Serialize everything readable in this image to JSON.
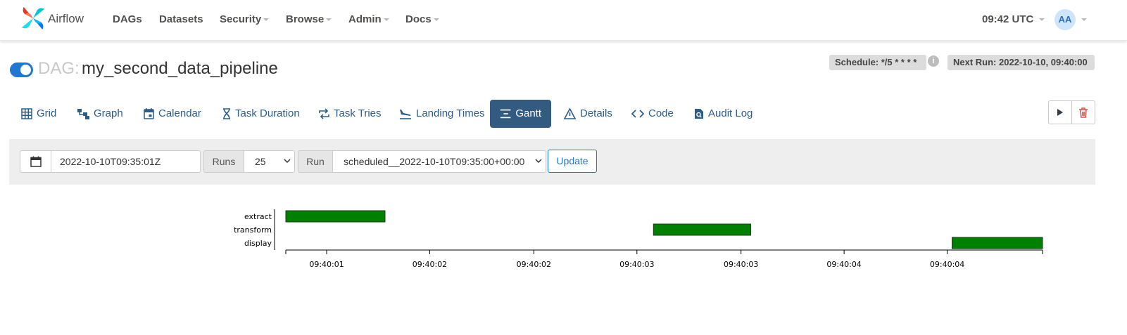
{
  "navbar": {
    "brand": "Airflow",
    "items": [
      {
        "label": "DAGs",
        "dropdown": false
      },
      {
        "label": "Datasets",
        "dropdown": false
      },
      {
        "label": "Security",
        "dropdown": true
      },
      {
        "label": "Browse",
        "dropdown": true
      },
      {
        "label": "Admin",
        "dropdown": true
      },
      {
        "label": "Docs",
        "dropdown": true
      }
    ],
    "clock": "09:42 UTC",
    "user_initials": "AA"
  },
  "dag": {
    "label": "DAG:",
    "id": "my_second_data_pipeline",
    "paused": false,
    "schedule": "Schedule: */5 * * * *",
    "next_run": "Next Run: 2022-10-10, 09:40:00"
  },
  "tabs": [
    {
      "label": "Grid",
      "icon": "grid-icon",
      "active": false
    },
    {
      "label": "Graph",
      "icon": "graph-icon",
      "active": false
    },
    {
      "label": "Calendar",
      "icon": "calendar-icon",
      "active": false
    },
    {
      "label": "Task Duration",
      "icon": "hourglass-icon",
      "active": false
    },
    {
      "label": "Task Tries",
      "icon": "repeat-icon",
      "active": false
    },
    {
      "label": "Landing Times",
      "icon": "plane-landing-icon",
      "active": false
    },
    {
      "label": "Gantt",
      "icon": "gantt-icon",
      "active": true
    },
    {
      "label": "Details",
      "icon": "warning-triangle-icon",
      "active": false
    },
    {
      "label": "Code",
      "icon": "code-icon",
      "active": false
    },
    {
      "label": "Audit Log",
      "icon": "file-search-icon",
      "active": false
    }
  ],
  "filters": {
    "base_date": "2022-10-10T09:35:01Z",
    "runs_label": "Runs",
    "runs_value": "25",
    "run_label": "Run",
    "run_value": "scheduled__2022-10-10T09:35:00+00:00",
    "update_label": "Update"
  },
  "colors": {
    "accent": "#1f78d1",
    "active_tab": "#335b82",
    "task_success": "#008000",
    "delete": "#d9534f"
  },
  "chart_data": {
    "type": "gantt",
    "tasks": [
      {
        "name": "extract",
        "start": 0.0,
        "end": 1.02,
        "state": "success"
      },
      {
        "name": "transform",
        "start": 3.78,
        "end": 4.78,
        "state": "success"
      },
      {
        "name": "display",
        "start": 6.85,
        "end": 7.78,
        "state": "success"
      }
    ],
    "time_unit": "seconds from first tick origin",
    "xlim": [
      0,
      7.78
    ],
    "tick_positions": [
      0.42,
      1.48,
      2.55,
      3.61,
      4.68,
      5.74,
      6.8
    ],
    "tick_labels": [
      "09:40:01",
      "09:40:02",
      "09:40:02",
      "09:40:03",
      "09:40:03",
      "09:40:04",
      "09:40:04"
    ],
    "bar_color": "#008000"
  }
}
